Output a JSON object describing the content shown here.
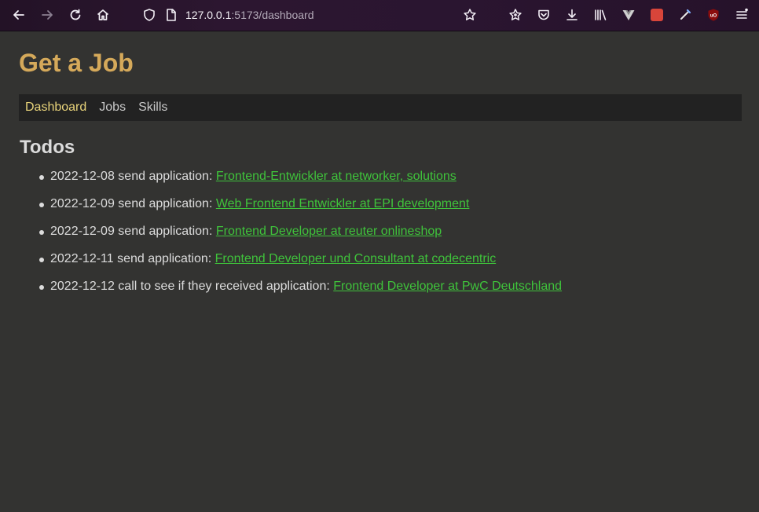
{
  "browser": {
    "url_host": "127.0.0.1",
    "url_path": ":5173/dashboard",
    "colors": {
      "toolbar_bg": "#2a1530"
    }
  },
  "app": {
    "title": "Get a Job",
    "nav": {
      "items": [
        {
          "label": "Dashboard",
          "active": true
        },
        {
          "label": "Jobs",
          "active": false
        },
        {
          "label": "Skills",
          "active": false
        }
      ]
    },
    "todos": {
      "heading": "Todos",
      "items": [
        {
          "date": "2022-12-08",
          "action": "send application:",
          "link": "Frontend-Entwickler at networker, solutions"
        },
        {
          "date": "2022-12-09",
          "action": "send application:",
          "link": "Web Frontend Entwickler at EPI development"
        },
        {
          "date": "2022-12-09",
          "action": "send application:",
          "link": "Frontend Developer at reuter onlineshop"
        },
        {
          "date": "2022-12-11",
          "action": "send application:",
          "link": "Frontend Developer und Consultant at codecentric"
        },
        {
          "date": "2022-12-12",
          "action": "call to see if they received application:",
          "link": "Frontend Developer at PwC Deutschland"
        }
      ]
    },
    "colors": {
      "title": "#d5a95a",
      "link": "#3fc33b",
      "nav_active": "#e8d37a",
      "background": "#333331"
    }
  }
}
